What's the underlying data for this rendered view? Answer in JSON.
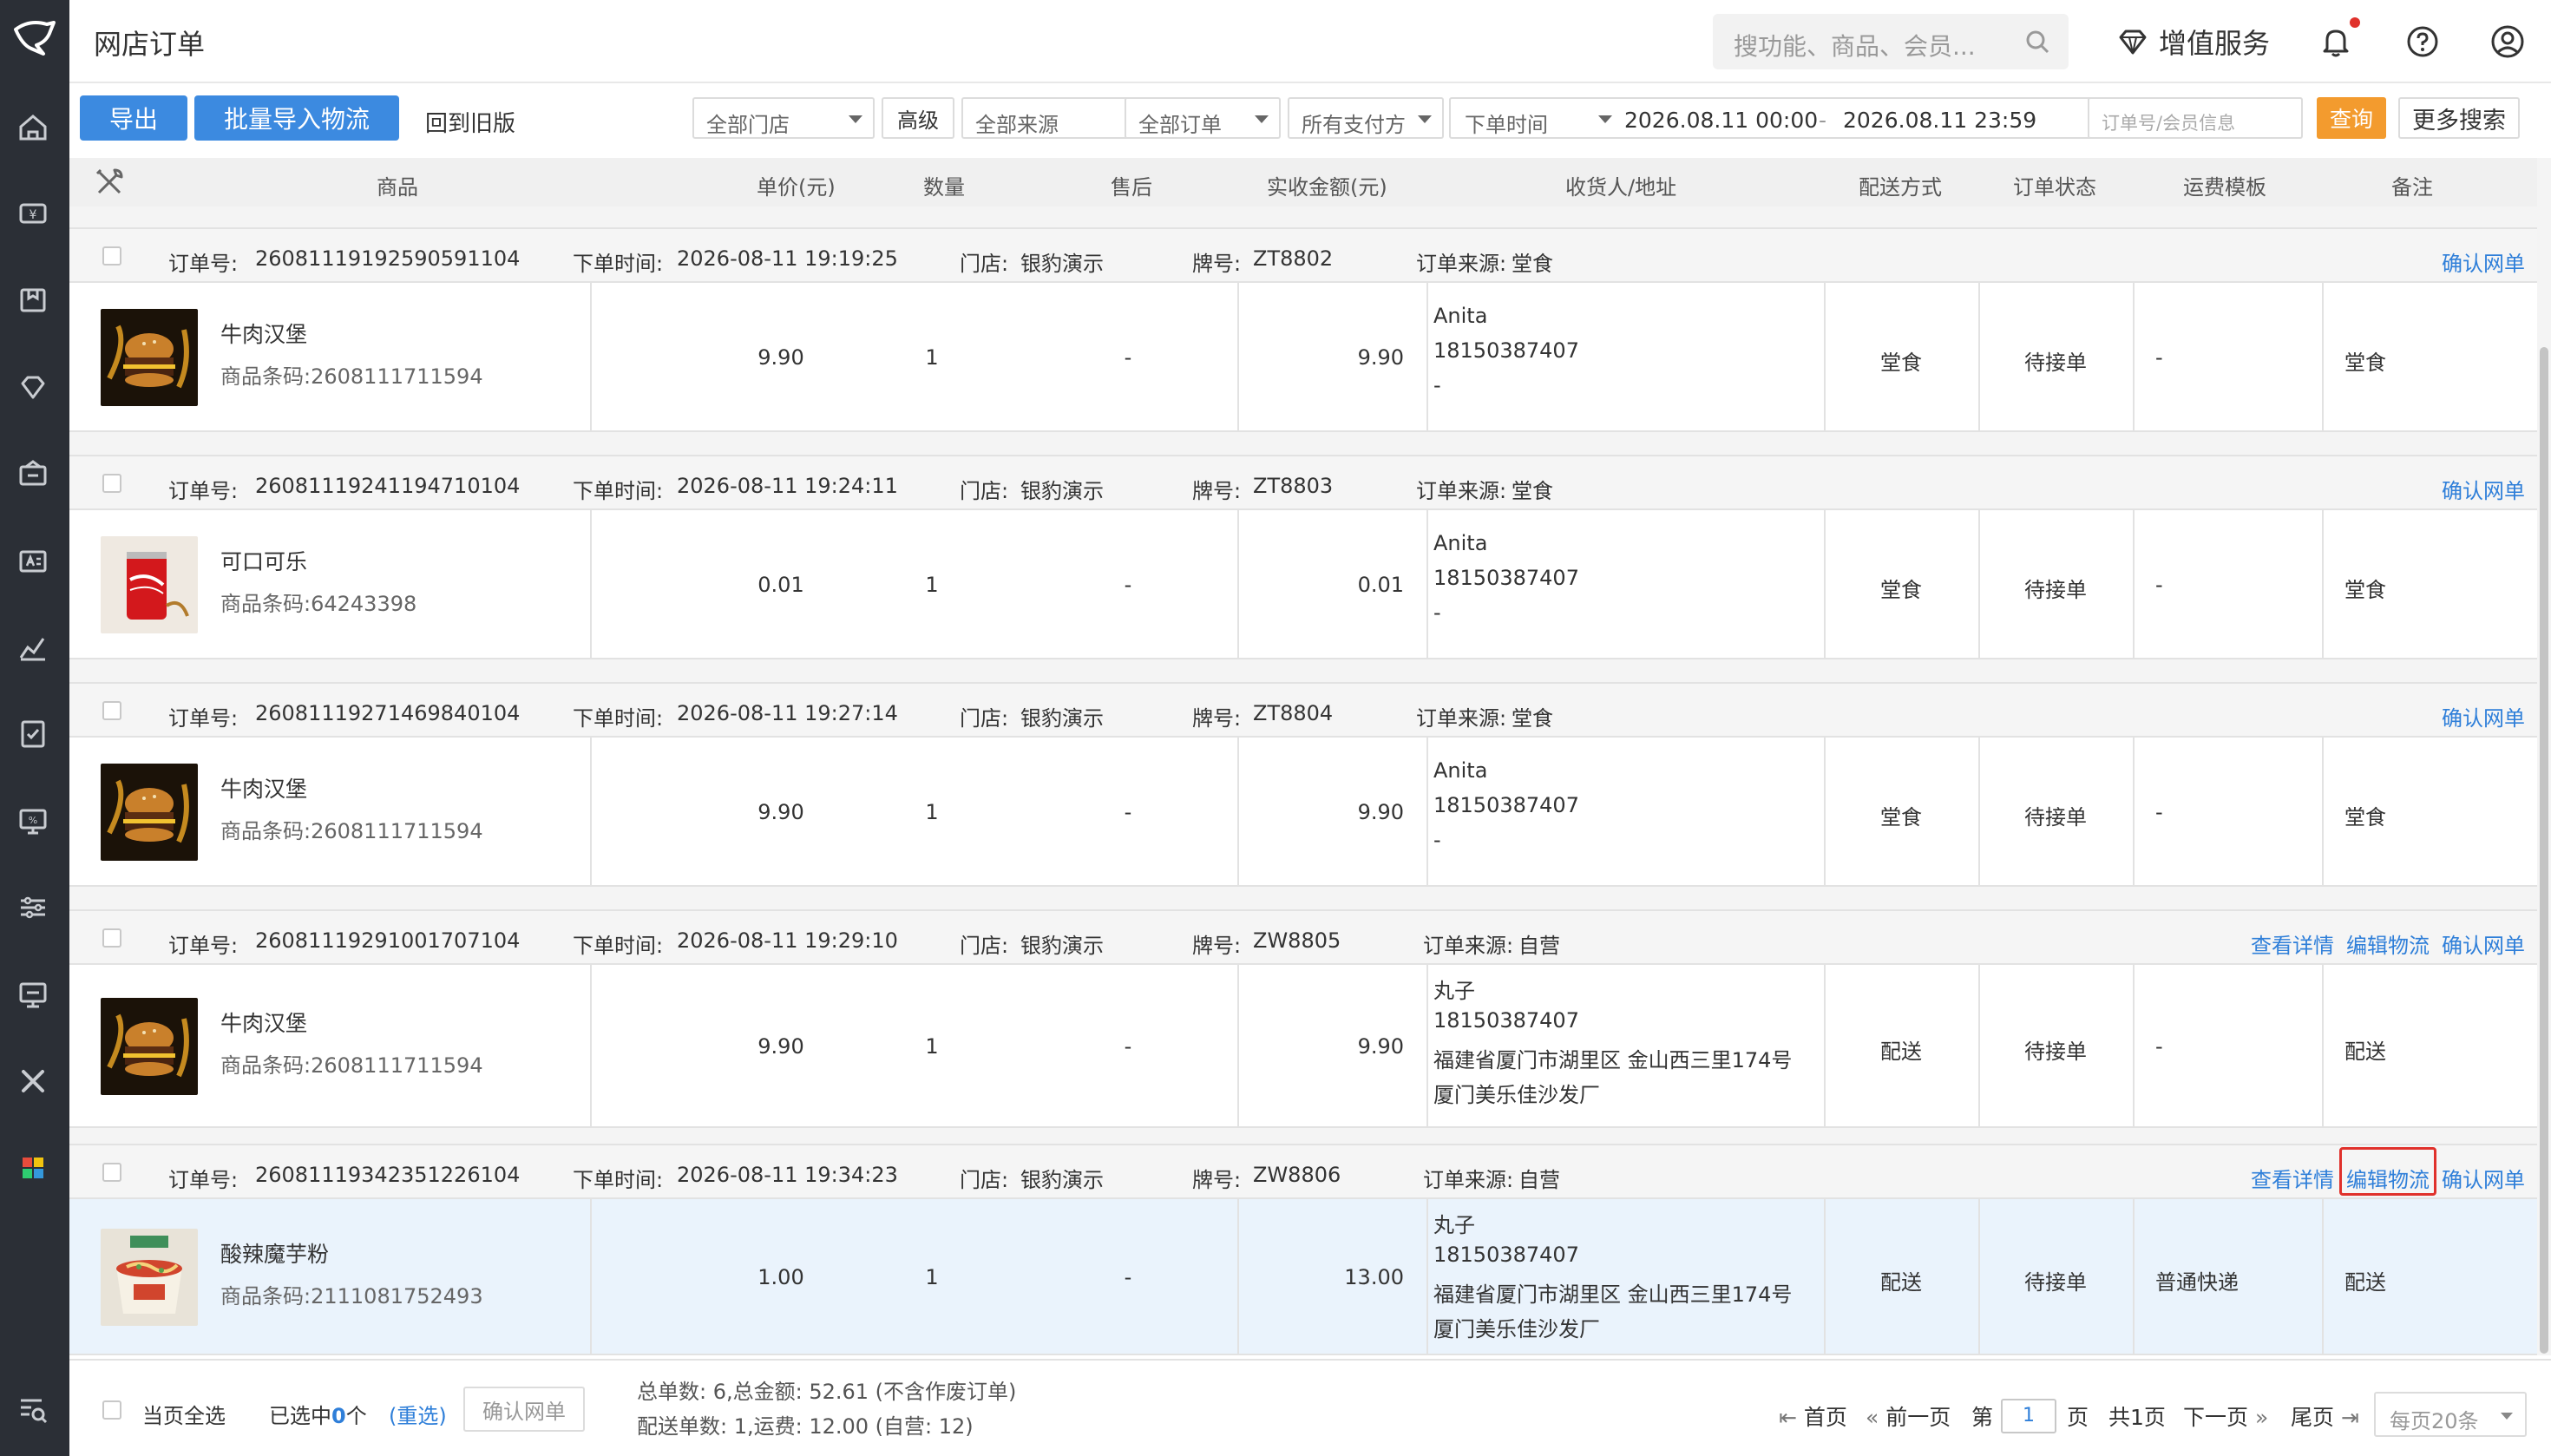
{
  "header": {
    "title": "网店订单",
    "search_placeholder": "搜功能、商品、会员...",
    "value_added": "增值服务"
  },
  "toolbar": {
    "export": "导出",
    "batch_import": "批量导入物流",
    "old_version": "回到旧版",
    "store": "全部门店",
    "advanced": "高级",
    "source": "全部来源",
    "orders": "全部订单",
    "payment": "所有支付方",
    "time_type": "下单时间",
    "date_from": "2026.08.11 00:00",
    "date_sep": "-",
    "date_to": "2026.08.11 23:59",
    "order_placeholder": "订单号/会员信息",
    "query": "查询",
    "more_search": "更多搜索"
  },
  "columns": [
    "商品",
    "单价(元)",
    "数量",
    "售后",
    "实收金额(元)",
    "收货人/地址",
    "配送方式",
    "订单状态",
    "运费模板",
    "备注"
  ],
  "labels": {
    "order_no": "订单号:",
    "order_time": "下单时间:",
    "store": "门店:",
    "plate": "牌号:",
    "source": "订单来源:",
    "barcode": "商品条码:",
    "view_detail": "查看详情",
    "edit_logistics": "编辑物流",
    "confirm_order": "确认网单"
  },
  "orders": [
    {
      "order_no": "26081119192590591104",
      "time": "2026-08-11 19:19:25",
      "store": "银豹演示",
      "plate": "ZT8802",
      "source": "堂食",
      "product": "牛肉汉堡",
      "barcode": "2608111711594",
      "price": "9.90",
      "qty": "1",
      "after_sale": "-",
      "amount": "9.90",
      "receiver": "Anita",
      "phone": "18150387407",
      "addr1": "-",
      "addr2": "",
      "delivery": "堂食",
      "status": "待接单",
      "freight": "-",
      "remark": "堂食",
      "thumb": "burger"
    },
    {
      "order_no": "26081119241194710104",
      "time": "2026-08-11 19:24:11",
      "store": "银豹演示",
      "plate": "ZT8803",
      "source": "堂食",
      "product": "可口可乐",
      "barcode": "64243398",
      "price": "0.01",
      "qty": "1",
      "after_sale": "-",
      "amount": "0.01",
      "receiver": "Anita",
      "phone": "18150387407",
      "addr1": "-",
      "addr2": "",
      "delivery": "堂食",
      "status": "待接单",
      "freight": "-",
      "remark": "堂食",
      "thumb": "cola"
    },
    {
      "order_no": "26081119271469840104",
      "time": "2026-08-11 19:27:14",
      "store": "银豹演示",
      "plate": "ZT8804",
      "source": "堂食",
      "product": "牛肉汉堡",
      "barcode": "2608111711594",
      "price": "9.90",
      "qty": "1",
      "after_sale": "-",
      "amount": "9.90",
      "receiver": "Anita",
      "phone": "18150387407",
      "addr1": "-",
      "addr2": "",
      "delivery": "堂食",
      "status": "待接单",
      "freight": "-",
      "remark": "堂食",
      "thumb": "burger"
    },
    {
      "order_no": "26081119291001707104",
      "time": "2026-08-11 19:29:10",
      "store": "银豹演示",
      "plate": "ZW8805",
      "source": "自营",
      "product": "牛肉汉堡",
      "barcode": "2608111711594",
      "price": "9.90",
      "qty": "1",
      "after_sale": "-",
      "amount": "9.90",
      "receiver": "丸子",
      "phone": "18150387407",
      "addr1": "福建省厦门市湖里区 金山西三里174号",
      "addr2": "厦门美乐佳沙发厂",
      "delivery": "配送",
      "status": "待接单",
      "freight": "-",
      "remark": "配送",
      "thumb": "burger"
    },
    {
      "order_no": "26081119342351226104",
      "time": "2026-08-11 19:34:23",
      "store": "银豹演示",
      "plate": "ZW8806",
      "source": "自营",
      "product": "酸辣魔芋粉",
      "barcode": "2111081752493",
      "price": "1.00",
      "qty": "1",
      "after_sale": "-",
      "amount": "13.00",
      "receiver": "丸子",
      "phone": "18150387407",
      "addr1": "福建省厦门市湖里区 金山西三里174号",
      "addr2": "厦门美乐佳沙发厂",
      "delivery": "配送",
      "status": "待接单",
      "freight": "普通快递",
      "remark": "配送",
      "thumb": "noodle"
    }
  ],
  "footer": {
    "select_page": "当页全选",
    "selected_prefix": "已选中",
    "selected_count": "0",
    "selected_suffix": "个",
    "reselect": "(重选)",
    "confirm": "确认网单",
    "summary1": "总单数: 6,总金额: 52.61 (不含作废订单)",
    "summary2": "配送单数: 1,运费: 12.00 (自营: 12)",
    "first": "首页",
    "prev": "前一页",
    "page_label": "第",
    "page_value": "1",
    "page_unit": "页",
    "total_pages": "共1页",
    "next": "下一页",
    "last": "尾页",
    "per_page": "每页20条"
  },
  "colors": {
    "sidebar": "#2b2f36",
    "primary": "#3c8ae0",
    "link": "#2f7fd9",
    "query": "#f39b2e",
    "highlight": "#e0312b"
  }
}
